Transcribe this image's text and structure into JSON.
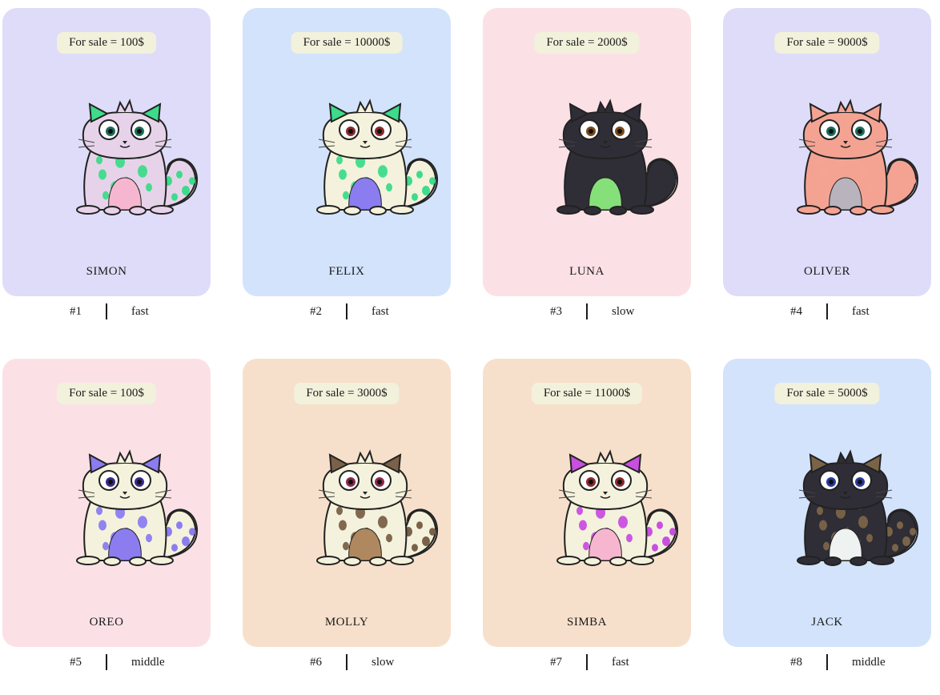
{
  "cats": [
    {
      "price_label": "For sale = 100$",
      "name": "SIMON",
      "id": "#1",
      "speed": "fast",
      "bg": "#dedcf9",
      "body": "#e6d3ea",
      "pattern": "#3ddb8a",
      "belly": "#f7b6cf",
      "ears": "#3ddb8a",
      "eyes": "#1e6b5a"
    },
    {
      "price_label": "For sale = 10000$",
      "name": "FELIX",
      "id": "#2",
      "speed": "fast",
      "bg": "#d3e3fc",
      "body": "#f4f2dc",
      "pattern": "#3ddb8a",
      "belly": "#8b7cf0",
      "ears": "#3ddb8a",
      "eyes": "#8a2a2a"
    },
    {
      "price_label": "For sale = 2000$",
      "name": "LUNA",
      "id": "#3",
      "speed": "slow",
      "bg": "#fbe1e6",
      "body": "#2f2d36",
      "pattern": "#2f2d36",
      "belly": "#86e07a",
      "ears": "#2f2d36",
      "eyes": "#7a4a1a"
    },
    {
      "price_label": "For sale = 9000$",
      "name": "OLIVER",
      "id": "#4",
      "speed": "fast",
      "bg": "#dedcf9",
      "body": "#f4a393",
      "pattern": "#f4a393",
      "belly": "#b9b3bd",
      "ears": "#f4a393",
      "eyes": "#1e6b5a"
    },
    {
      "price_label": "For sale = 100$",
      "name": "OREO",
      "id": "#5",
      "speed": "middle",
      "bg": "#fbe1e6",
      "body": "#f4f2dc",
      "pattern": "#8b7cf0",
      "belly": "#8b7cf0",
      "ears": "#8b7cf0",
      "eyes": "#3a2a8a"
    },
    {
      "price_label": "For sale = 3000$",
      "name": "MOLLY",
      "id": "#6",
      "speed": "slow",
      "bg": "#f7e0cb",
      "body": "#f4f2dc",
      "pattern": "#7a6148",
      "belly": "#b08860",
      "ears": "#7a6148",
      "eyes": "#8a2a4a"
    },
    {
      "price_label": "For sale = 11000$",
      "name": "SIMBA",
      "id": "#7",
      "speed": "fast",
      "bg": "#f7e0cb",
      "body": "#f4f2dc",
      "pattern": "#c94fe0",
      "belly": "#f7b6cf",
      "ears": "#c94fe0",
      "eyes": "#8a2a2a"
    },
    {
      "price_label": "For sale = 5000$",
      "name": "JACK",
      "id": "#8",
      "speed": "middle",
      "bg": "#d3e3fc",
      "body": "#2f2d36",
      "pattern": "#7a6448",
      "belly": "#eef2f0",
      "ears": "#7a6448",
      "eyes": "#2a3a9a"
    }
  ]
}
